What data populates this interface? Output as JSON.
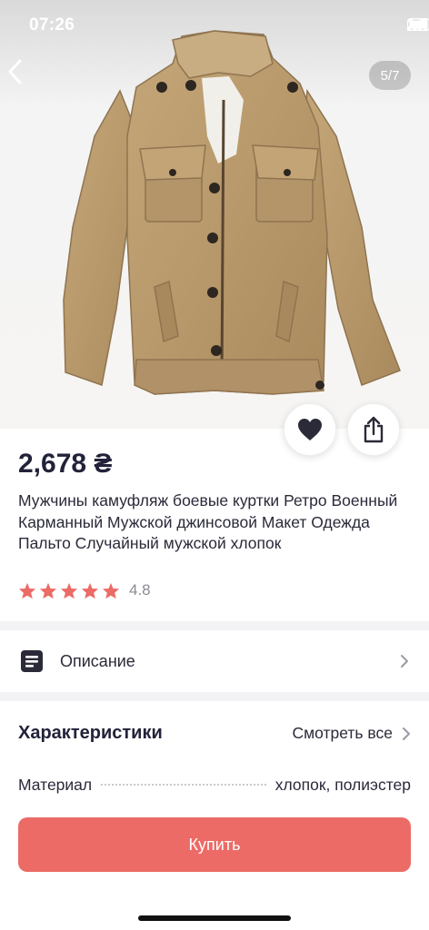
{
  "status_bar": {
    "time": "07:26"
  },
  "gallery": {
    "counter": "5/7"
  },
  "product": {
    "price": "2,678 ₴",
    "title": "Мужчины камуфляж боевые куртки Ретро Военный Карманный Мужской джинсовой Макет Одежда Пальто Случайный мужской хлопок",
    "rating": "4.8",
    "stars_filled": 5
  },
  "description": {
    "label": "Описание"
  },
  "specs": {
    "title": "Характеристики",
    "see_all": "Смотреть все",
    "rows": [
      {
        "name": "Материал",
        "value": "хлопок, полиэстер"
      }
    ]
  },
  "buy_button": {
    "label": "Купить"
  },
  "colors": {
    "accent": "#ec6b66",
    "star": "#ec6b66",
    "jacket": "#b89a6c"
  }
}
